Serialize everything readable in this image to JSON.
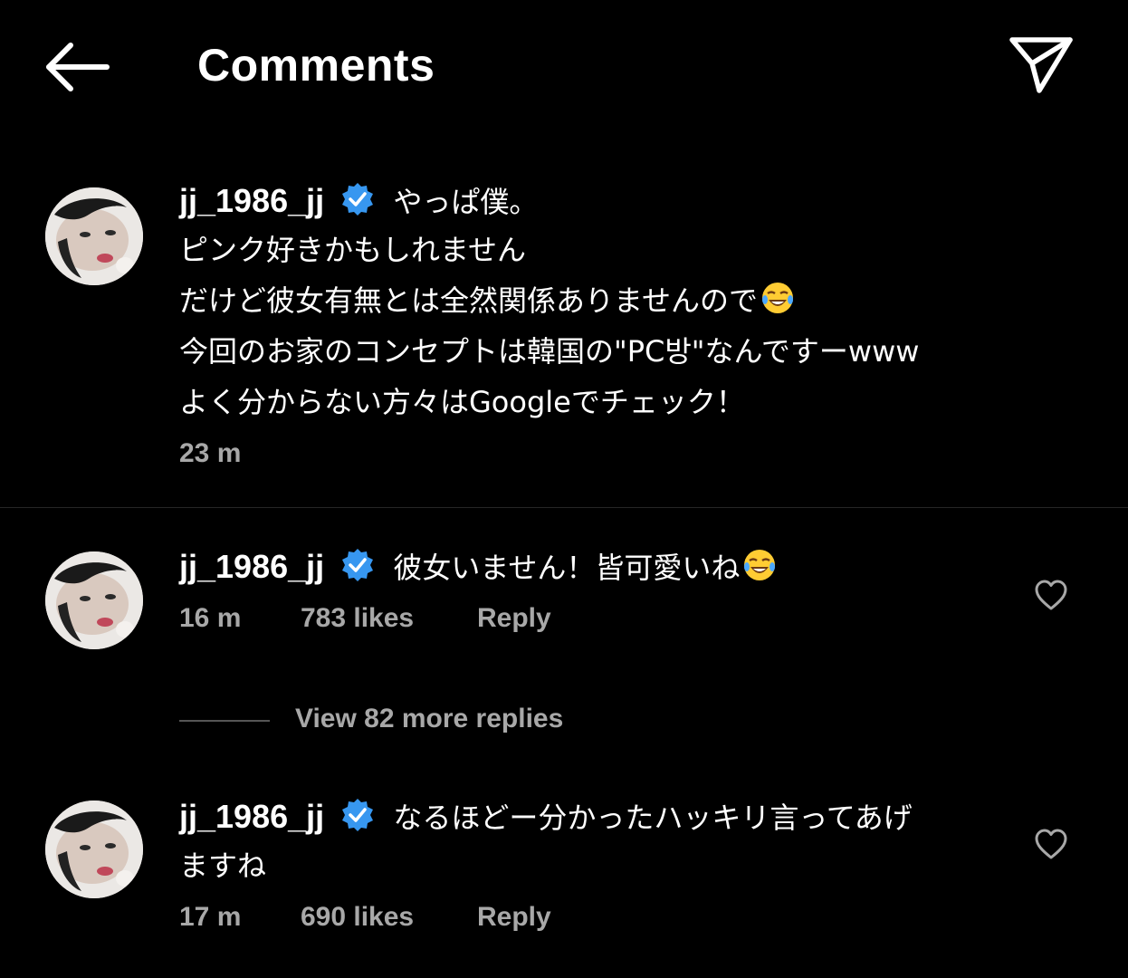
{
  "header": {
    "title": "Comments",
    "back_icon": "arrow-left-icon",
    "share_icon": "paper-plane-icon"
  },
  "caption": {
    "username": "jj_1986_jj",
    "verified": true,
    "lines": [
      "やっぱ僕。",
      "ピンク好きかもしれません",
      "だけど彼女有無とは全然関係ありませんので",
      "今回のお家のコンセプトは韓国の\"PC방\"なんですーwww",
      "よく分からない方々はGoogleでチェック！"
    ],
    "time": "23 m"
  },
  "comments": [
    {
      "username": "jj_1986_jj",
      "verified": true,
      "text_lines": [
        "彼女いません！皆可愛いね"
      ],
      "time": "16 m",
      "likes": "783 likes",
      "reply_label": "Reply"
    },
    {
      "username": "jj_1986_jj",
      "verified": true,
      "text_lines": [
        "なるほどー分かったハッキリ言ってあげ",
        "ますね"
      ],
      "time": "17 m",
      "likes": "690 likes",
      "reply_label": "Reply"
    }
  ],
  "view_replies": {
    "label": "View 82 more replies"
  },
  "colors": {
    "background": "#000000",
    "text": "#ffffff",
    "secondary_text": "#a8a8a8",
    "verified_badge": "#3797f0",
    "divider": "#262626"
  }
}
